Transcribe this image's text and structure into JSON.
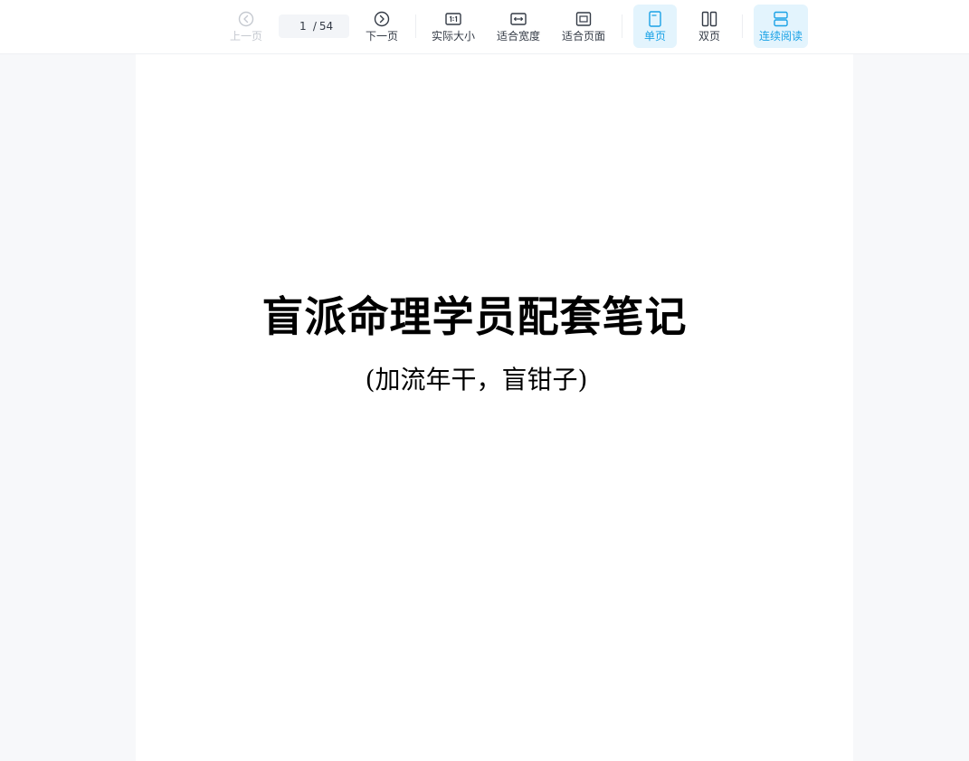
{
  "toolbar": {
    "prev_label": "上一页",
    "next_label": "下一页",
    "current_page": "1",
    "page_separator": "/",
    "total_pages": "54",
    "actual_size_label": "实际大小",
    "fit_width_label": "适合宽度",
    "fit_page_label": "适合页面",
    "single_page_label": "单页",
    "double_page_label": "双页",
    "continuous_label": "连续阅读",
    "accent_color": "#1aa2e6",
    "icons": {
      "prev": "chevron-left-circle-icon",
      "next": "chevron-right-circle-icon",
      "actual_size": "one-to-one-icon",
      "fit_width": "fit-width-icon",
      "fit_page": "fit-page-icon",
      "single_page": "single-page-icon",
      "double_page": "double-page-icon",
      "continuous": "continuous-scroll-icon"
    }
  },
  "document": {
    "title": "盲派命理学员配套笔记",
    "subtitle": "(加流年干，盲钳子)"
  }
}
